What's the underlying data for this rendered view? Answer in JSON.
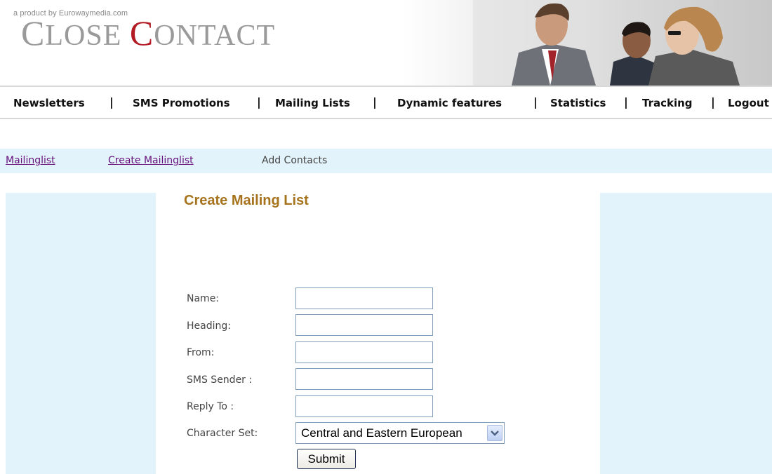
{
  "header": {
    "tagline": "a product by Eurowaymedia.com",
    "logo_text": "CLOSE CONTACT",
    "photo_icon": "business-people-photo"
  },
  "nav": {
    "items": [
      {
        "label": "Newsletters"
      },
      {
        "label": "SMS Promotions"
      },
      {
        "label": "Mailing Lists"
      },
      {
        "label": "Dynamic features"
      },
      {
        "label": "Statistics"
      },
      {
        "label": "Tracking"
      },
      {
        "label": "Logout"
      }
    ],
    "separator": "|"
  },
  "subnav": {
    "mailinglist": "Mailinglist",
    "create_mailinglist": "Create Mailinglist",
    "add_contacts": "Add Contacts"
  },
  "main": {
    "title": "Create Mailing List",
    "fields": [
      {
        "label": "Name:",
        "value": ""
      },
      {
        "label": "Heading:",
        "value": ""
      },
      {
        "label": "From:",
        "value": ""
      },
      {
        "label": "SMS Sender :",
        "value": ""
      },
      {
        "label": "Reply To :",
        "value": ""
      }
    ],
    "charset": {
      "label": "Character Set:",
      "selected": "Central and Eastern European"
    },
    "submit_label": "Submit"
  },
  "colors": {
    "panel": "#e3f3fb",
    "title": "#a6731c",
    "link": "#660e7a",
    "logo_accent": "#b31b24"
  }
}
